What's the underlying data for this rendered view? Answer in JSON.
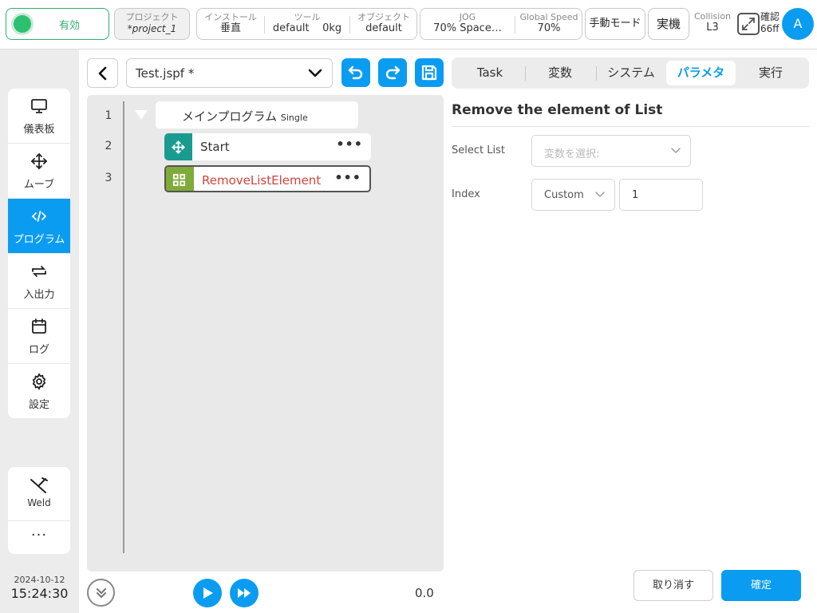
{
  "topbar": {
    "enable_label": "有効",
    "project_label": "プロジェクト",
    "project_value": "*project_1",
    "install_label": "インストール",
    "install_value": "垂直",
    "tool_label": "ツール",
    "tool_value_name": "default",
    "tool_value_weight": "0kg",
    "object_label": "オブジェクト",
    "object_value": "default",
    "jog_label": "JOG",
    "jog_value": "70%   Space…",
    "speed_label": "Global Speed",
    "speed_value": "70%",
    "mode_label": "手動モード",
    "real_label": "実機",
    "collision_label": "Collision",
    "collision_value": "L3",
    "confirm_line1": "確認",
    "confirm_line2": "66ff",
    "avatar_letter": "A"
  },
  "sidebar": {
    "items": [
      {
        "label": "儀表板",
        "icon": "monitor-icon"
      },
      {
        "label": "ムーブ",
        "icon": "move-icon"
      },
      {
        "label": "プログラム",
        "icon": "code-icon"
      },
      {
        "label": "入出力",
        "icon": "io-icon"
      },
      {
        "label": "ログ",
        "icon": "calendar-icon"
      },
      {
        "label": "設定",
        "icon": "gear-icon"
      }
    ],
    "weld_label": "Weld",
    "more_label": "···",
    "date": "2024-10-12",
    "time": "15:24:30"
  },
  "program": {
    "file_name": "Test.jspf *",
    "line_numbers": [
      "1",
      "2",
      "3"
    ],
    "main_node": "メインプログラム",
    "main_node_sub": "Single",
    "nodes": [
      {
        "label": "Start",
        "color": "#1a9b8f",
        "text_color": "#333333"
      },
      {
        "label": "RemoveListElement",
        "color": "#7fab3a",
        "text_color": "#d0443a"
      }
    ],
    "node_menu": "•••",
    "speed_readout": "0.0"
  },
  "tabs": [
    {
      "label": "Task"
    },
    {
      "label": "変数"
    },
    {
      "label": "システム"
    },
    {
      "label": "パラメタ"
    },
    {
      "label": "実行"
    }
  ],
  "panel": {
    "title": "Remove the element of List",
    "select_list_label": "Select List",
    "select_list_placeholder": "変数を選択:",
    "index_label": "Index",
    "index_mode": "Custom",
    "index_value": "1",
    "cancel_label": "取り消す",
    "ok_label": "確定"
  },
  "colors": {
    "accent": "#0a9cf0",
    "enable_green": "#2fae6c"
  }
}
